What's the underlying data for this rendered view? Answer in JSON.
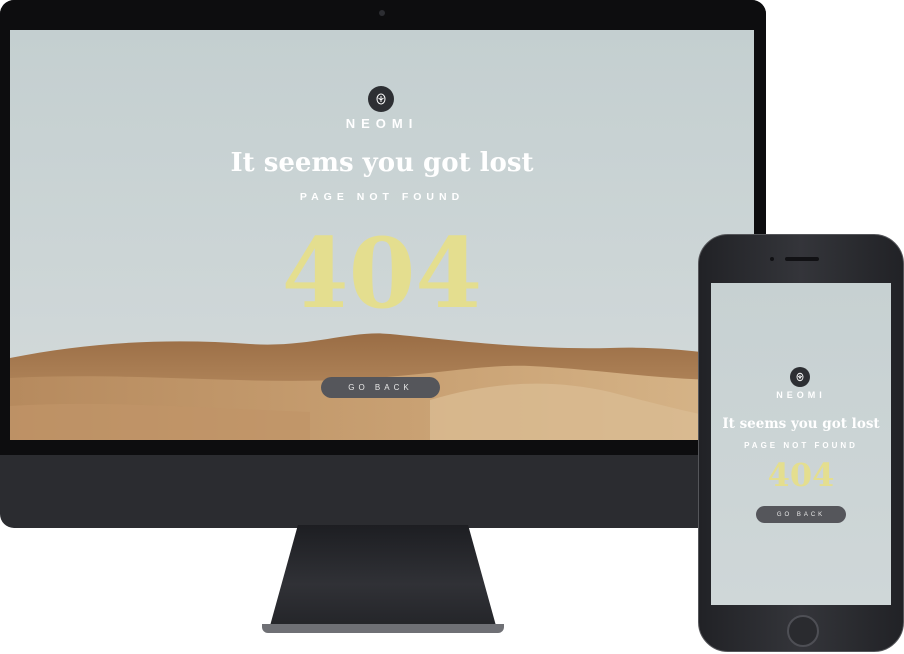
{
  "desktop": {
    "brand": "NEOMI",
    "title": "It seems you got lost",
    "subtitle": "PAGE NOT FOUND",
    "error_code": "404",
    "button_label": "GO BACK"
  },
  "mobile": {
    "brand": "NEOMI",
    "title": "It seems you got lost",
    "subtitle": "PAGE NOT FOUND",
    "error_code": "404",
    "button_label": "GO BACK"
  },
  "colors": {
    "sky": "#c8d2d3",
    "sand": "#b98c5d",
    "error_code": "#e4de8f",
    "button": "#55565b",
    "device_body": "#2b2c30"
  },
  "icons": {
    "logo": "rose-icon"
  }
}
